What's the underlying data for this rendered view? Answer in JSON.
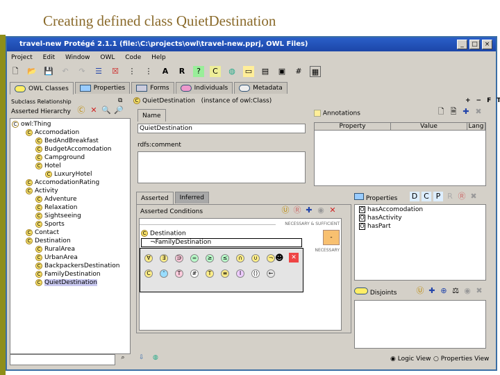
{
  "slide_title": "Creating defined class QuietDestination",
  "window": {
    "title": "travel-new  Protégé 2.1.1     (file:\\C:\\projects\\owl\\travel-new.pprj, OWL Files)",
    "min": "_",
    "max": "□",
    "close": "×"
  },
  "menu": [
    "Project",
    "Edit",
    "Window",
    "OWL",
    "Code",
    "Help"
  ],
  "tabs": [
    "OWL Classes",
    "Properties",
    "Forms",
    "Individuals",
    "Metadata"
  ],
  "left": {
    "header": "Subclass Relationship",
    "hierarchy_label": "Asserted Hierarchy",
    "tree": [
      {
        "label": "owl:Thing",
        "depth": 0
      },
      {
        "label": "Accomodation",
        "depth": 1
      },
      {
        "label": "BedAndBreakfast",
        "depth": 2
      },
      {
        "label": "BudgetAccomodation",
        "depth": 2
      },
      {
        "label": "Campground",
        "depth": 2
      },
      {
        "label": "Hotel",
        "depth": 2
      },
      {
        "label": "LuxuryHotel",
        "depth": 3
      },
      {
        "label": "AccomodationRating",
        "depth": 1
      },
      {
        "label": "Activity",
        "depth": 1
      },
      {
        "label": "Adventure",
        "depth": 2
      },
      {
        "label": "Relaxation",
        "depth": 2
      },
      {
        "label": "Sightseeing",
        "depth": 2
      },
      {
        "label": "Sports",
        "depth": 2
      },
      {
        "label": "Contact",
        "depth": 1
      },
      {
        "label": "Destination",
        "depth": 1
      },
      {
        "label": "RuralArea",
        "depth": 2
      },
      {
        "label": "UrbanArea",
        "depth": 2
      },
      {
        "label": "BackpackersDestination",
        "depth": 2
      },
      {
        "label": "FamilyDestination",
        "depth": 2
      },
      {
        "label": "QuietDestination",
        "depth": 2
      }
    ],
    "search_value": ""
  },
  "class_header": {
    "name": "QuietDestination",
    "type": "(instance of owl:Class)",
    "controls": [
      "+",
      "−",
      "F",
      "T"
    ]
  },
  "name_tab": "Name",
  "name_value": "QuietDestination",
  "comment_label": "rdfs:comment",
  "annotations": {
    "label": "Annotations",
    "columns": [
      "Property",
      "Value",
      "Lang"
    ]
  },
  "cond_tabs": [
    "Asserted",
    "Inferred"
  ],
  "conditions": {
    "label": "Asserted Conditions",
    "nec_suff": "NECESSARY & SUFFICIENT",
    "necessary": "NECESSARY",
    "rows": [
      "Destination",
      "¬FamilyDestination"
    ],
    "minus_btn": "-",
    "symbols_row1": [
      "∀",
      "∃",
      "∋",
      "=",
      "≥",
      "≤",
      "∩",
      "∪",
      "¬"
    ],
    "symbols_row2": [
      "C",
      "'",
      "T",
      "#",
      "T",
      "≡",
      "I",
      "()",
      "←"
    ]
  },
  "properties": {
    "label": "Properties",
    "items": [
      "hasAccomodation",
      "hasActivity",
      "hasPart"
    ]
  },
  "disjoints": {
    "label": "Disjoints"
  },
  "views": {
    "logic": "Logic View",
    "properties": "Properties View",
    "selected": "logic"
  }
}
